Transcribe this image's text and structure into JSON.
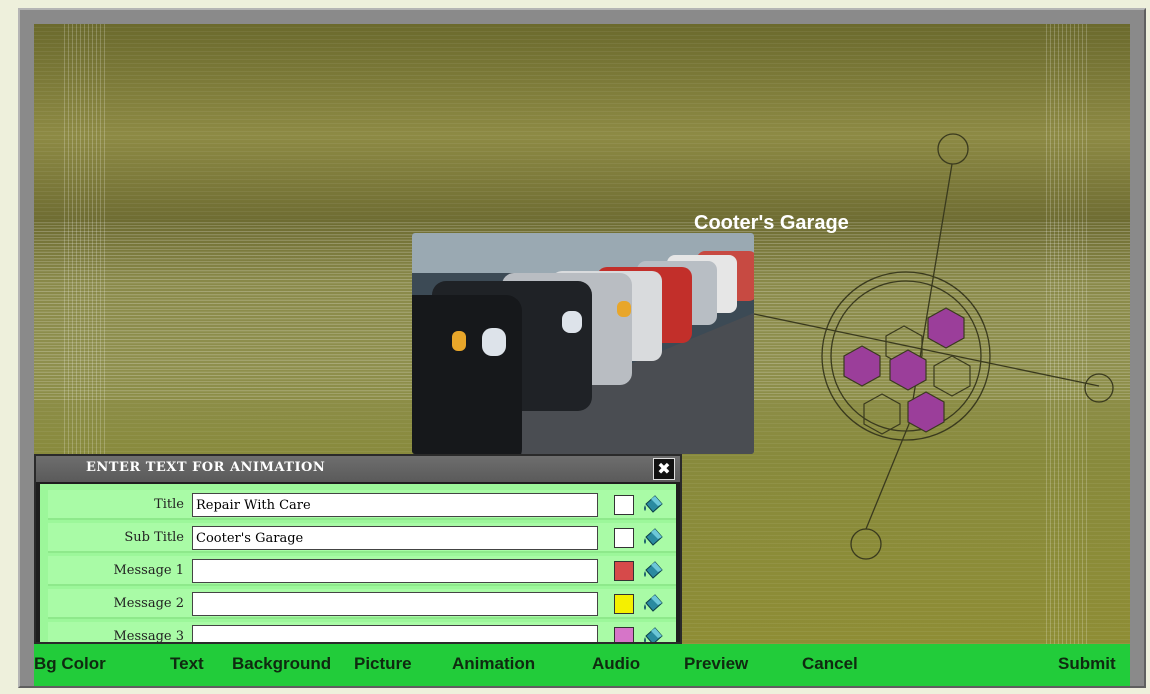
{
  "site": {
    "title": "Cooter's Garage"
  },
  "dialog": {
    "title": "ENTER TEXT FOR ANIMATION",
    "close_symbol": "✖",
    "rows": [
      {
        "label": "Title",
        "value": "Repair With Care",
        "color": "#ffffff"
      },
      {
        "label": "Sub Title",
        "value": "Cooter's Garage",
        "color": "#ffffff"
      },
      {
        "label": "Message 1",
        "value": "",
        "color": "#d64a4a"
      },
      {
        "label": "Message 2",
        "value": "",
        "color": "#f5f000"
      },
      {
        "label": "Message 3",
        "value": "",
        "color": "#d675c8"
      }
    ]
  },
  "toolbar": {
    "bg_color": "Bg Color",
    "text": "Text",
    "background": "Background",
    "picture": "Picture",
    "animation": "Animation",
    "audio": "Audio",
    "preview": "Preview",
    "cancel": "Cancel",
    "submit": "Submit"
  },
  "colors": {
    "toolbar": "#22cc3a",
    "dialog_body": "#9cf79a",
    "hexagon": "#9b3e9a"
  }
}
